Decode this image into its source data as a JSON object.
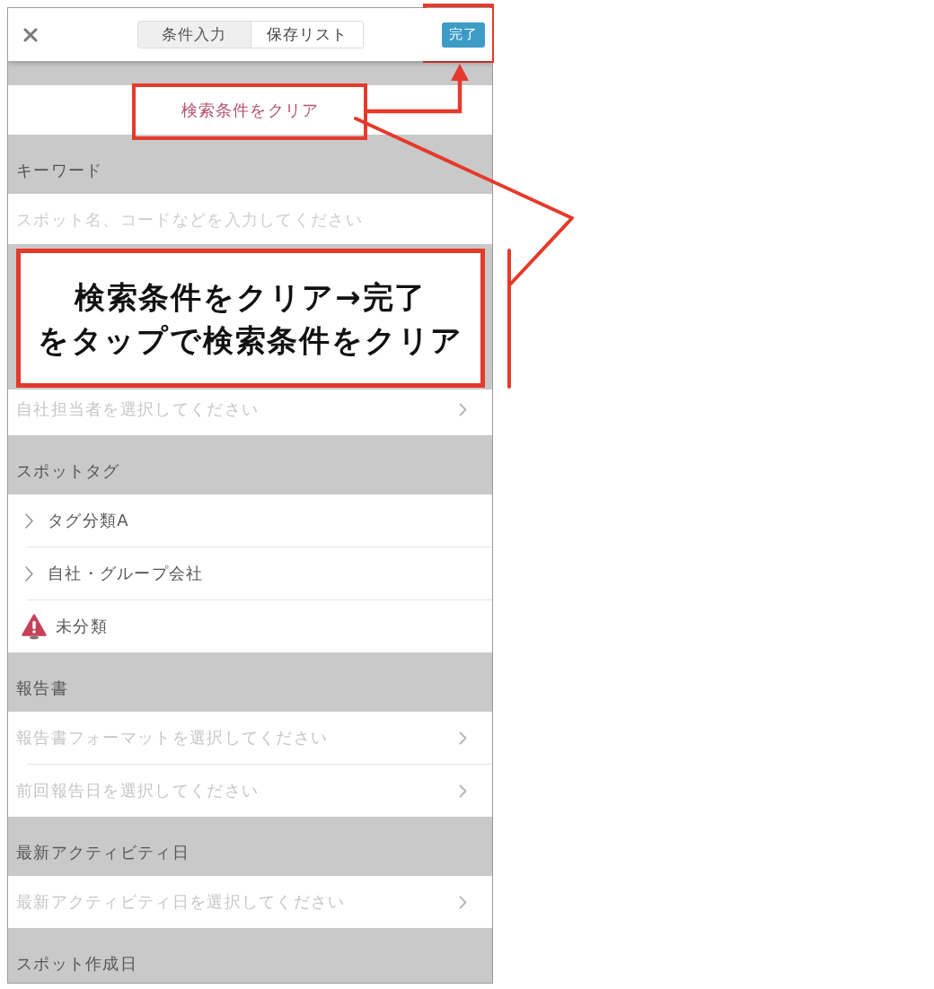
{
  "nav": {
    "tabs": [
      {
        "label": "条件入力",
        "selected": true
      },
      {
        "label": "保存リスト",
        "selected": false
      }
    ],
    "done_button": "完了"
  },
  "clear_button": "検索条件をクリア",
  "sections": [
    {
      "title": "キーワード",
      "rows": [
        {
          "kind": "input",
          "placeholder": "スポット名、コードなどを入力してください"
        }
      ]
    },
    {
      "rows": [
        {
          "kind": "select",
          "placeholder": "自社担当者を選択してください"
        }
      ]
    },
    {
      "title": "スポットタグ",
      "rows": [
        {
          "kind": "group",
          "label": "タグ分類A"
        },
        {
          "kind": "group",
          "label": "自社・グループ会社"
        },
        {
          "kind": "warning",
          "label": "未分類"
        }
      ]
    },
    {
      "title": "報告書",
      "rows": [
        {
          "kind": "select",
          "placeholder": "報告書フォーマットを選択してください"
        },
        {
          "kind": "select",
          "placeholder": "前回報告日を選択してください"
        }
      ]
    },
    {
      "title": "最新アクティビティ日",
      "rows": [
        {
          "kind": "select",
          "placeholder": "最新アクティビティ日を選択してください"
        }
      ]
    },
    {
      "title": "スポット作成日"
    }
  ],
  "annotations": {
    "callout_lines": [
      "検索条件をクリア→完了",
      "をタップで検索条件をクリア"
    ]
  }
}
